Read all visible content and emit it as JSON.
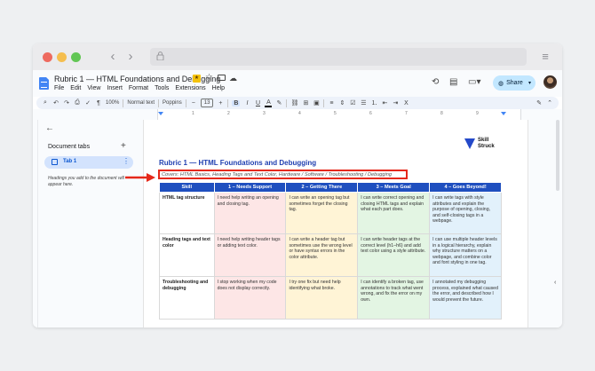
{
  "browser": {
    "back": "‹",
    "forward": "›",
    "menu": "≡"
  },
  "doc": {
    "title": "Rubric 1 — HTML Foundations and Debugging",
    "badge": "★",
    "menu": [
      "File",
      "Edit",
      "View",
      "Insert",
      "Format",
      "Tools",
      "Extensions",
      "Help"
    ],
    "share_label": "Share"
  },
  "toolbar": {
    "zoom": "100%",
    "style": "Normal text",
    "font": "Poppins",
    "font_size": "13",
    "minus": "−",
    "plus": "+",
    "bold": "B",
    "italic": "I",
    "underline": "U",
    "text_color": "A"
  },
  "ruler": [
    "1",
    "2",
    "3",
    "4",
    "5",
    "6",
    "7",
    "8",
    "9"
  ],
  "sidebar": {
    "header": "Document tabs",
    "add": "+",
    "tab1_label": "Tab 1",
    "hint": "Headings you add to the document will appear here."
  },
  "page": {
    "logo_line1": "Skill",
    "logo_line2": "Struck",
    "heading": "Rubric 1 — HTML Foundations and Debugging",
    "covers": "Covers: HTML Basics, Heading Tags and Text Color, Hardware / Software / Troubleshooting / Debugging"
  },
  "rubric": {
    "headers": [
      "Skill",
      "1 – Needs Support",
      "2 – Getting There",
      "3 – Meets Goal",
      "4 – Goes Beyond!"
    ],
    "rows": [
      {
        "skill": "HTML tag structure",
        "c1": "I need help writing an opening and closing tag.",
        "c2": "I can write an opening tag but sometimes forget the closing tag.",
        "c3": "I can write correct opening and closing HTML tags and explain what each part does.",
        "c4": "I can write tags with style attributes and explain the purpose of opening, closing, and self-closing tags in a webpage."
      },
      {
        "skill": "Heading tags and text color",
        "c1": "I need help writing header tags or adding text color.",
        "c2": "I can write a header tag but sometimes use the wrong level or have syntax errors in the color attribute.",
        "c3": "I can write header tags at the correct level (h1–h6) and add text color using a style attribute.",
        "c4": "I can use multiple header levels in a logical hierarchy, explain why structure matters on a webpage, and combine color and font styling in one tag."
      },
      {
        "skill": "Troubleshooting and debugging",
        "c1": "I stop working when my code does not display correctly.",
        "c2": "I try one fix but need help identifying what broke.",
        "c3": "I can identify a broken tag, use annotations to track what went wrong, and fix the error on my own.",
        "c4": "I annotated my debugging process, explained what caused the error, and described how I would prevent the future."
      }
    ]
  },
  "colors": {
    "header_blue": "#1f4fbf",
    "annotation_red": "#e5281a",
    "needs_support": "#fde6e6",
    "getting_there": "#fff4d6",
    "meets_goal": "#e3f5e3",
    "goes_beyond": "#e2f1fb"
  },
  "icons": [
    "lock-icon",
    "docs-icon",
    "star-icon",
    "folder-icon",
    "cloud-icon",
    "history-icon",
    "comment-icon",
    "video-icon",
    "globe-icon",
    "search-icon",
    "undo-icon",
    "redo-icon",
    "print-icon",
    "spellcheck-icon",
    "paint-format-icon",
    "link-icon",
    "image-icon",
    "align-icon",
    "list-icon",
    "pencil-icon",
    "arrow-left-icon",
    "red-arrow-icon"
  ]
}
